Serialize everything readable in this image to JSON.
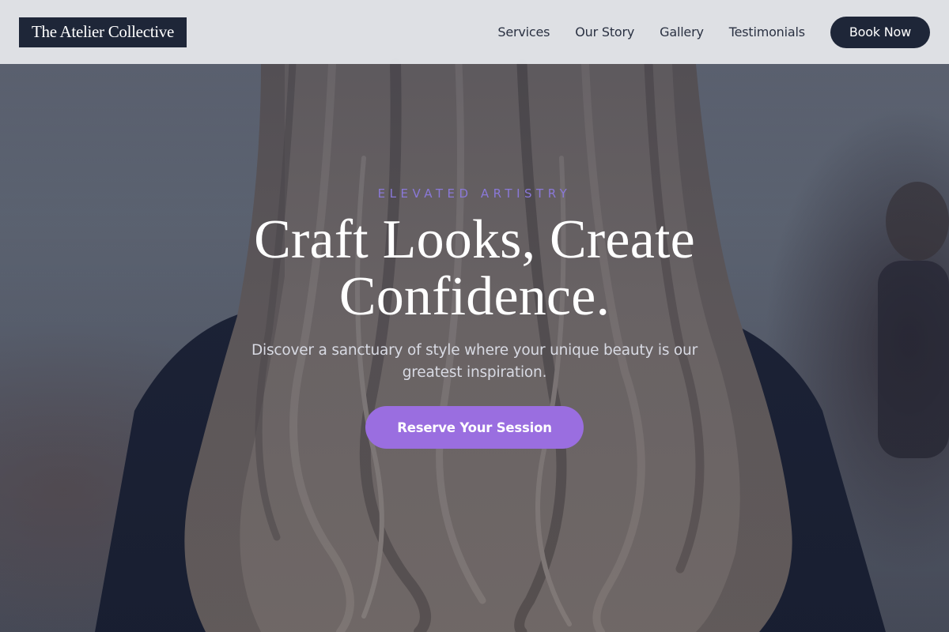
{
  "header": {
    "brand": "The Atelier Collective",
    "nav": [
      {
        "label": "Services"
      },
      {
        "label": "Our Story"
      },
      {
        "label": "Gallery"
      },
      {
        "label": "Testimonials"
      }
    ],
    "book_label": "Book Now"
  },
  "hero": {
    "eyebrow": "ELEVATED ARTISTRY",
    "headline_line1": "Craft Looks, Create",
    "headline_line2": "Confidence.",
    "subtext": "Discover a sanctuary of style where your unique beauty is our greatest inspiration.",
    "cta_label": "Reserve Your Session",
    "image_alt_icon": "hair-model-photo"
  },
  "colors": {
    "brand_dark": "#1e2638",
    "accent_purple": "#9a6ee0",
    "eyebrow_purple": "#8a78d8",
    "header_bg": "#e2e4e8"
  }
}
